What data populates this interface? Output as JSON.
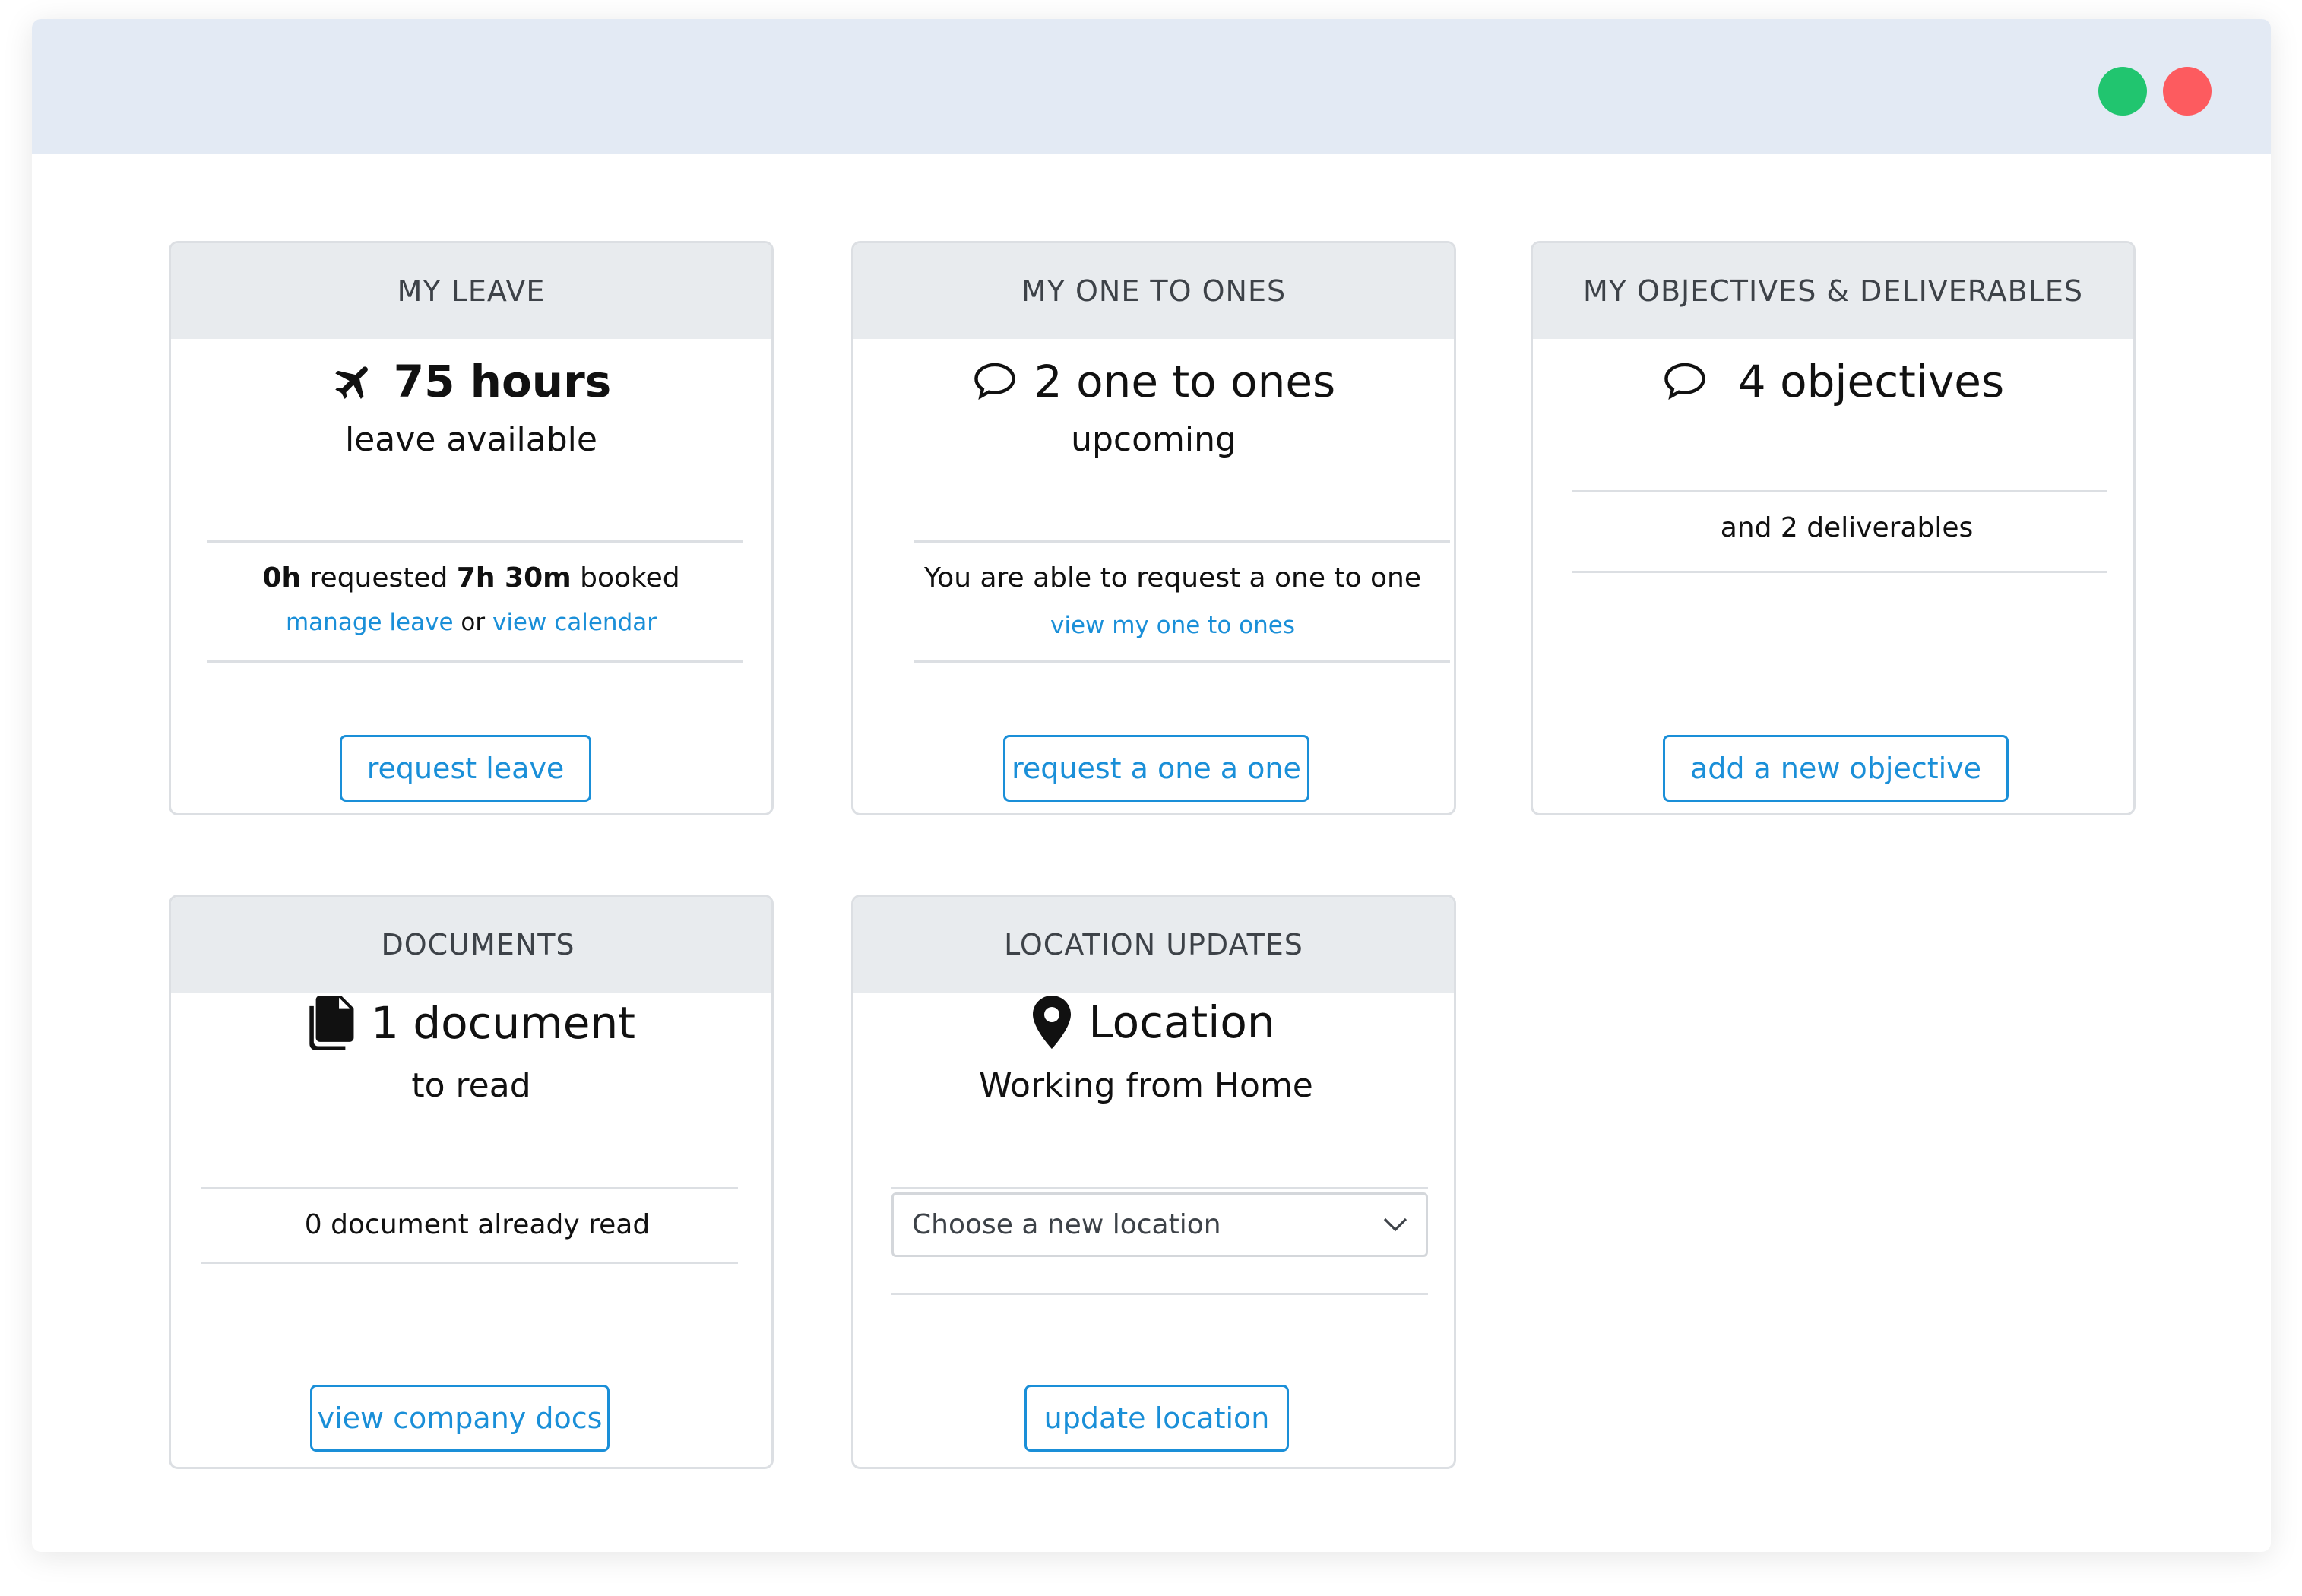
{
  "window": {
    "controls": [
      {
        "name": "green-window-dot",
        "color": "#21c56f"
      },
      {
        "name": "red-window-dot",
        "color": "#fd5b5f"
      }
    ]
  },
  "cards": {
    "leave": {
      "title": "MY LEAVE",
      "icon": "airplane-icon",
      "value": "75 hours",
      "subtitle": "leave available",
      "requested_value": "0h",
      "requested_label": "requested",
      "booked_value": "7h 30m",
      "booked_label": "booked",
      "manage_link": "manage leave",
      "or_text": "or",
      "calendar_link": "view calendar",
      "button": "request leave"
    },
    "one_to_ones": {
      "title": "MY ONE TO ONES",
      "icon": "speech-bubble-icon",
      "value": "2 one to ones",
      "subtitle": "upcoming",
      "info": "You are able to request a one to one",
      "link": "view my one to ones",
      "button": "request a one a one"
    },
    "objectives": {
      "title": "MY OBJECTIVES & DELIVERABLES",
      "icon": "speech-bubble-icon",
      "value": "4 objectives",
      "info": "and 2 deliverables",
      "button": "add a new objective"
    },
    "documents": {
      "title": "DOCUMENTS",
      "icon": "documents-icon",
      "value": "1 document",
      "subtitle": "to read",
      "info": "0 document  already read",
      "button": "view company docs"
    },
    "location": {
      "title": "LOCATION UPDATES",
      "icon": "map-pin-icon",
      "value": "Location",
      "subtitle": "Working from Home",
      "select_placeholder": "Choose a new location",
      "button": "update location"
    }
  },
  "colors": {
    "accent": "#1a8fd8",
    "titlebar": "#e3eaf4",
    "card_header": "#e8ebee"
  }
}
